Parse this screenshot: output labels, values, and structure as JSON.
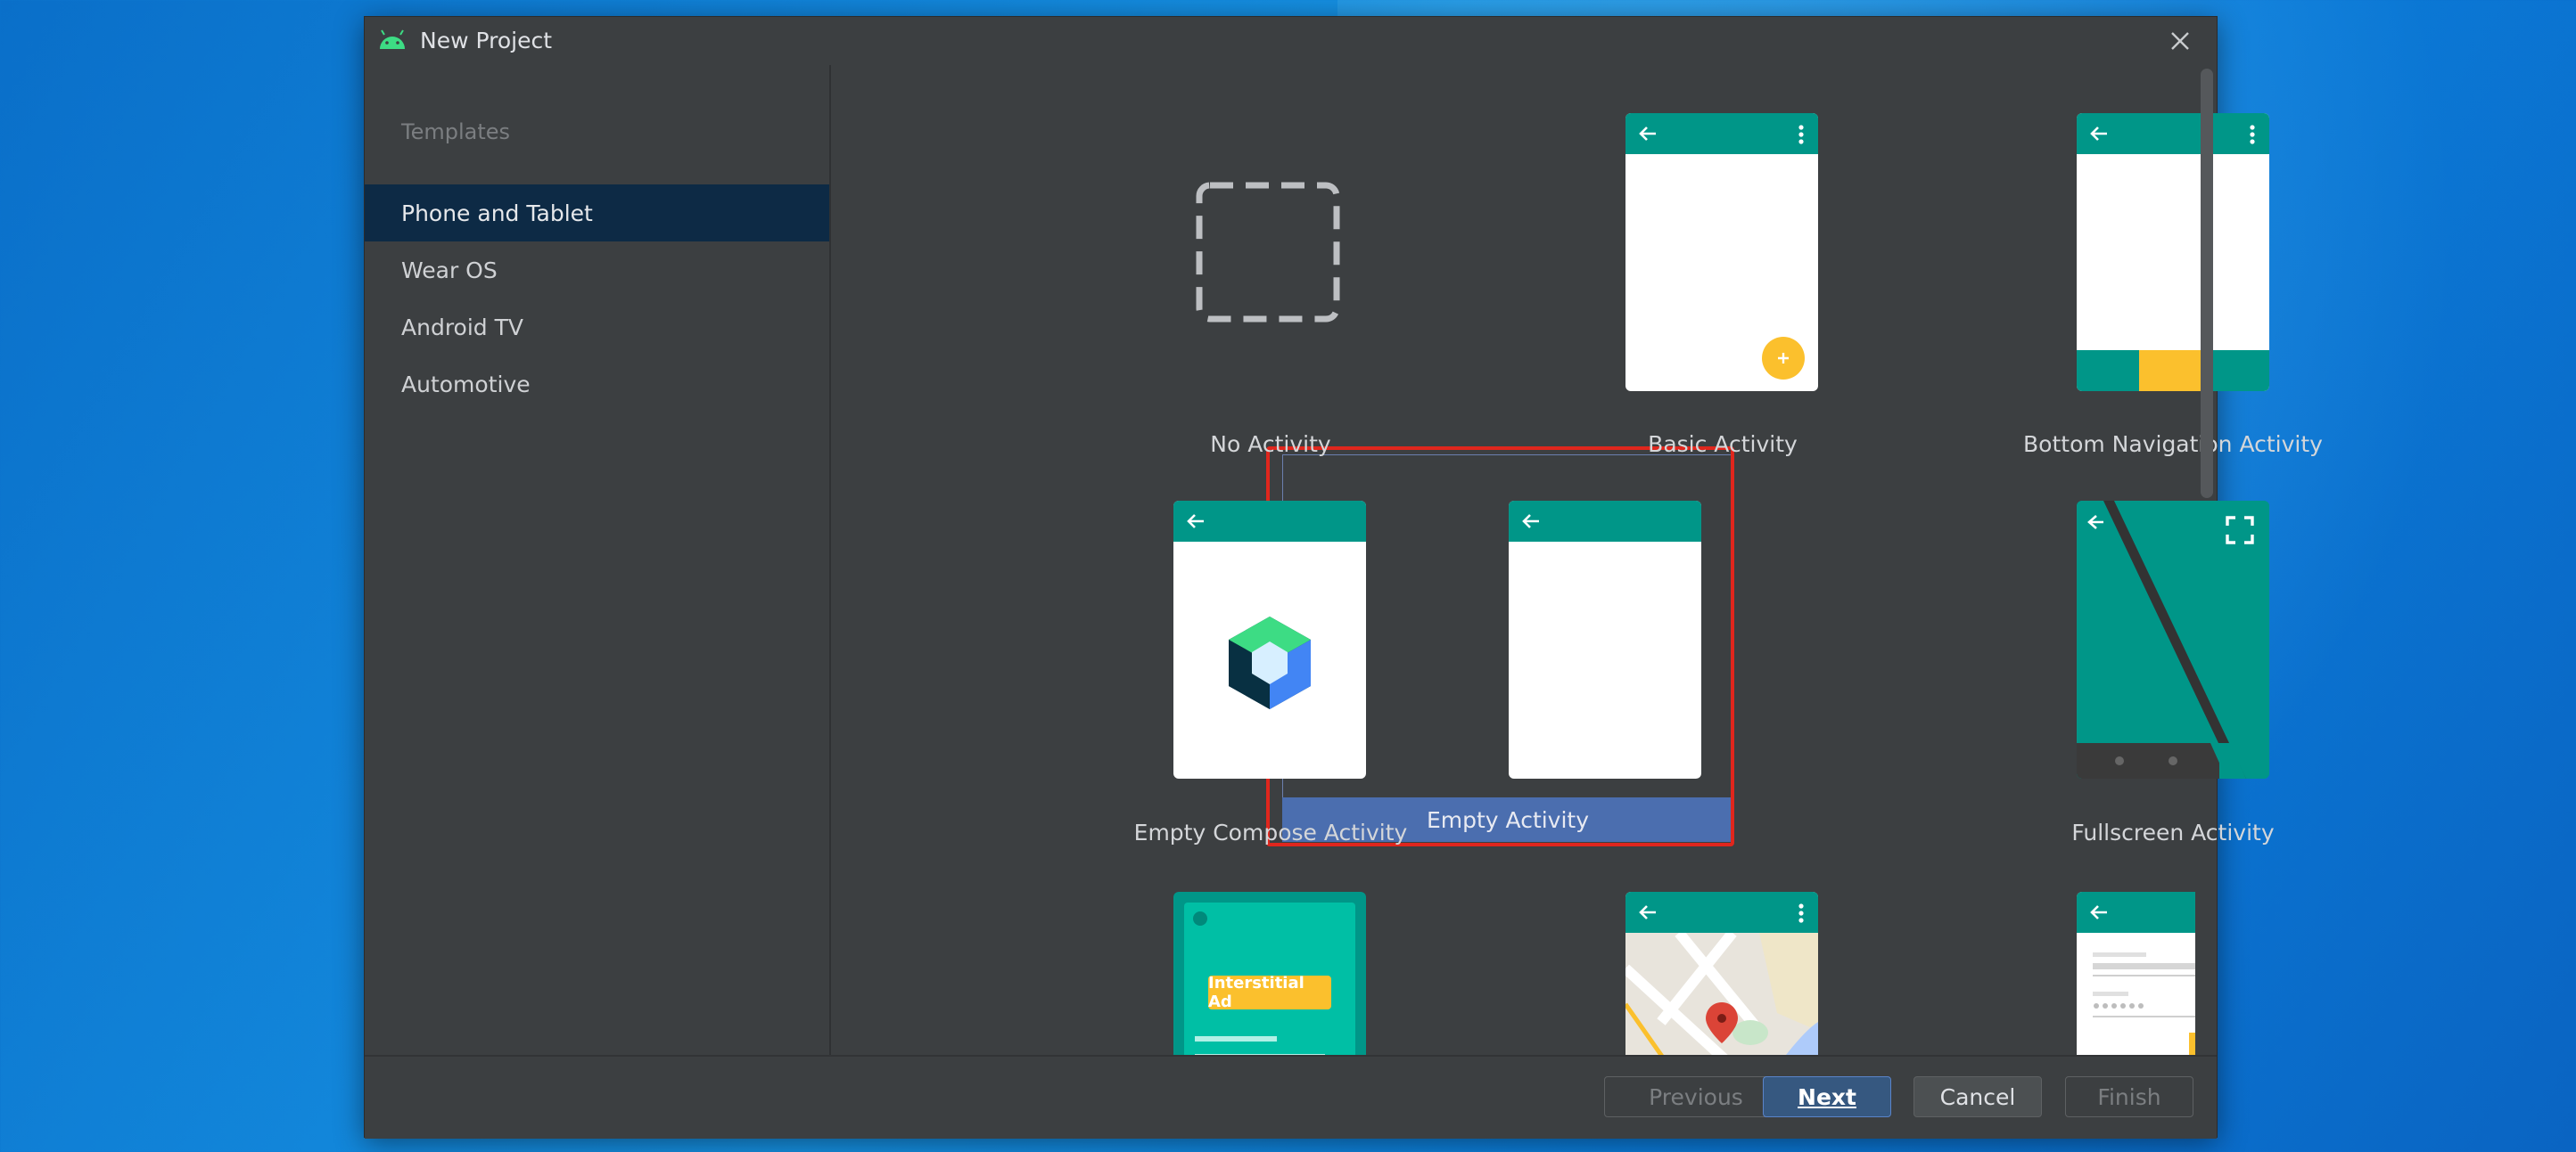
{
  "dialog": {
    "title": "New Project"
  },
  "sidebar": {
    "heading": "Templates",
    "items": [
      {
        "label": "Phone and Tablet",
        "selected": true
      },
      {
        "label": "Wear OS"
      },
      {
        "label": "Android TV"
      },
      {
        "label": "Automotive"
      }
    ]
  },
  "templates": [
    {
      "label": "No Activity"
    },
    {
      "label": "Basic Activity"
    },
    {
      "label": "Bottom Navigation Activity"
    },
    {
      "label": "Empty Compose Activity"
    },
    {
      "label": "Empty Activity",
      "selected": true
    },
    {
      "label": "Fullscreen Activity"
    },
    {
      "label": "",
      "preview_text": "Interstitial Ad"
    },
    {
      "label": ""
    },
    {
      "label": ""
    }
  ],
  "footer": {
    "previous": "Previous",
    "next": "Next",
    "cancel": "Cancel",
    "finish": "Finish"
  },
  "colors": {
    "appbar": "#009688",
    "accent_yellow": "#fbc02d",
    "selection_outline": "#e0261d",
    "selected_label_bg": "#4b6eaf"
  }
}
